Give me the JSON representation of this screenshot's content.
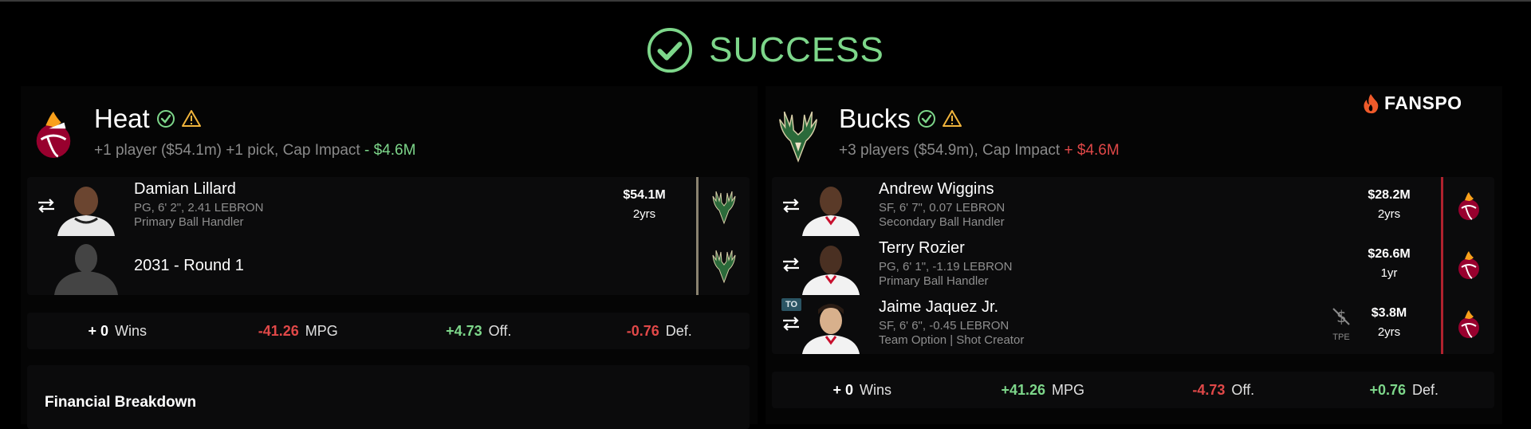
{
  "header": {
    "status": "SUCCESS",
    "accent": "#7dd68a"
  },
  "brand": {
    "name": "FANSPO"
  },
  "left": {
    "team": "Heat",
    "summary_prefix": "+1 player ($54.1m) +1 pick, Cap Impact",
    "summary_impact": "- $4.6M",
    "players": [
      {
        "name": "Damian Lillard",
        "details": "PG, 6' 2\", 2.41 LEBRON",
        "role": "Primary Ball Handler",
        "salary": "$54.1M",
        "years": "2yrs",
        "to": "bucks-logo-icon"
      }
    ],
    "picks": [
      {
        "label": "2031 - Round 1",
        "to": "bucks-logo-icon"
      }
    ],
    "stats": [
      {
        "value": "+ 0",
        "unit": "Wins",
        "tone": "zero"
      },
      {
        "value": "-41.26",
        "unit": "MPG",
        "tone": "neg"
      },
      {
        "value": "+4.73",
        "unit": "Off.",
        "tone": "pos"
      },
      {
        "value": "-0.76",
        "unit": "Def.",
        "tone": "neg"
      }
    ],
    "financial_title": "Financial Breakdown"
  },
  "right": {
    "team": "Bucks",
    "summary_prefix": "+3 players ($54.9m), Cap Impact",
    "summary_impact": "+ $4.6M",
    "players": [
      {
        "name": "Andrew Wiggins",
        "details": "SF, 6' 7\", 0.07 LEBRON",
        "role": "Secondary Ball Handler",
        "salary": "$28.2M",
        "years": "2yrs",
        "to": "heat-logo-icon"
      },
      {
        "name": "Terry Rozier",
        "details": "PG, 6' 1\", -1.19 LEBRON",
        "role": "Primary Ball Handler",
        "salary": "$26.6M",
        "years": "1yr",
        "to": "heat-logo-icon"
      },
      {
        "name": "Jaime Jaquez Jr.",
        "details": "SF, 6' 6\", -0.45 LEBRON",
        "role": "Team Option | Shot Creator",
        "salary": "$3.8M",
        "years": "2yrs",
        "tag": "TO",
        "tpe": "TPE",
        "to": "heat-logo-icon"
      }
    ],
    "stats": [
      {
        "value": "+ 0",
        "unit": "Wins",
        "tone": "zero"
      },
      {
        "value": "+41.26",
        "unit": "MPG",
        "tone": "pos"
      },
      {
        "value": "-4.73",
        "unit": "Off.",
        "tone": "neg"
      },
      {
        "value": "+0.76",
        "unit": "Def.",
        "tone": "pos"
      }
    ]
  }
}
